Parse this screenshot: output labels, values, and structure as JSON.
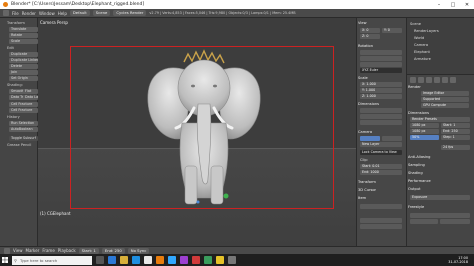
{
  "window": {
    "title": "Blender* [C:\\Users\\Jessam\\Desktop\\Elephant_rigged.blend]"
  },
  "header": {
    "menu": [
      "File",
      "Render",
      "Window",
      "Help"
    ],
    "layout": "Default",
    "scene": "Scene",
    "engine": "Cycles Render",
    "stats": "v2.79 | Verts:4,853 | Faces:5,046 | Tris:9,980 | Objects:0/3 | Lamps:0/1 | Mem: 25.4MB"
  },
  "toolshelf": {
    "sections": [
      "Transform",
      "Edit",
      "History",
      "Grease Pencil"
    ],
    "items": [
      "Translate",
      "Rotate",
      "Scale",
      "Duplicate",
      "Duplicate Linked",
      "Delete",
      "Join",
      "Set Origin",
      "Shading:",
      "Smooth",
      "Flat",
      "Data Transfer",
      "Data Lay",
      "Cell Fracture",
      "Cell Fracture",
      "Run Selection",
      "AutoBoolean",
      "Toggle Subsurf"
    ]
  },
  "viewport": {
    "label": "Camera Persp",
    "bottom_label": "(1) CGElephant"
  },
  "props_panel": {
    "sections": [
      "View",
      "Rotation",
      "XYZ Euler",
      "Dimensions",
      "Scale",
      "Camera",
      "Transform",
      "3D Cursor",
      "Item"
    ],
    "fields": [
      "X: 0",
      "Y: 0",
      "Z: 0",
      "X: 1.000",
      "Y: 1.000",
      "Z: 1.000",
      "New Layer",
      "Lock Camera to View",
      "Clip:",
      "Start: 0.01",
      "End: 1000"
    ]
  },
  "outliner": {
    "items": [
      "Scene",
      "RenderLayers",
      "World",
      "Camera",
      "Elephant",
      "Armature"
    ]
  },
  "property_editor": {
    "sections": [
      "Render",
      "Dimensions",
      "Anti-Aliasing",
      "Sampling",
      "Shading",
      "Performance",
      "Output",
      "Freestyle"
    ],
    "fields": [
      "Image Editor",
      "Supported",
      "GPU Compute",
      "Render Presets",
      "1080 px",
      "1080 px",
      "50%",
      "Start: 1",
      "End: 250",
      "Step: 1",
      "24 fps",
      "Exposure"
    ]
  },
  "timeline": {
    "items": [
      "View",
      "Marker",
      "Frame",
      "Playback",
      "Start: 1",
      "End: 250",
      "No Sync"
    ]
  },
  "taskbar": {
    "search_placeholder": "Type here to search",
    "time": "17:00",
    "date": "31-07-2018"
  },
  "colors": {
    "camera_frame": "#cc2222",
    "accent": "#5680c2",
    "blender_orange": "#e87d0d"
  }
}
